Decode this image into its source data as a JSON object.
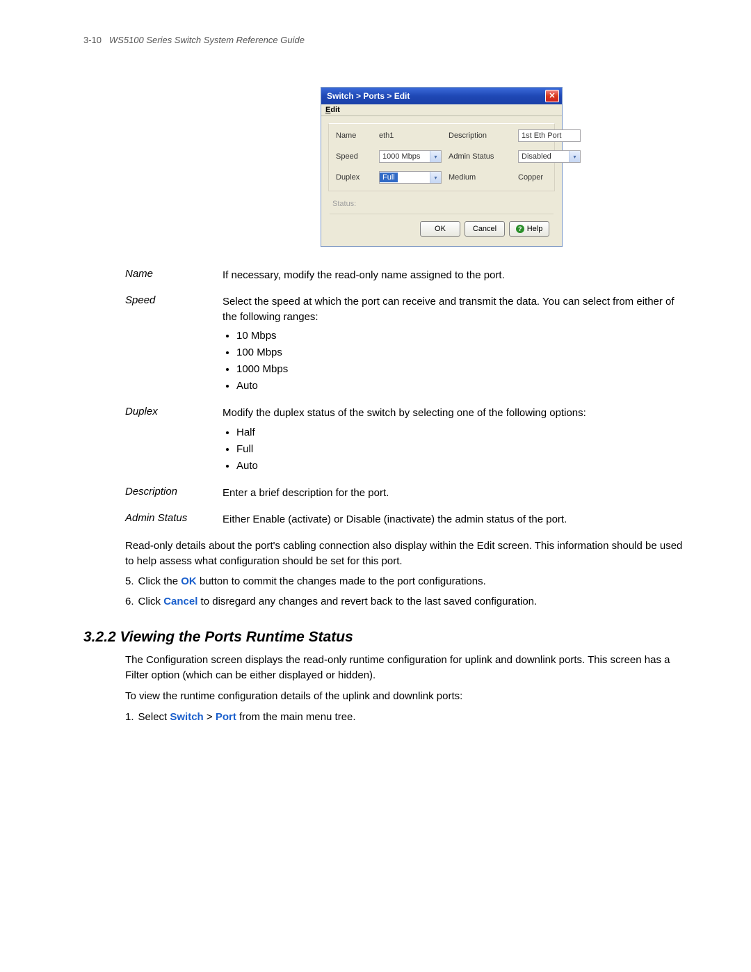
{
  "header": {
    "page_num": "3-10",
    "doc_title": "WS5100 Series Switch System Reference Guide"
  },
  "dialog": {
    "title": "Switch > Ports > Edit",
    "menu": {
      "edit": "Edit"
    },
    "fields": {
      "name_label": "Name",
      "name_value": "eth1",
      "speed_label": "Speed",
      "speed_value": "1000 Mbps",
      "duplex_label": "Duplex",
      "duplex_value": "Full",
      "description_label": "Description",
      "description_value": "1st Eth Port",
      "admin_status_label": "Admin Status",
      "admin_status_value": "Disabled",
      "medium_label": "Medium",
      "medium_value": "Copper"
    },
    "status_label": "Status:",
    "buttons": {
      "ok": "OK",
      "cancel": "Cancel",
      "help": "Help"
    }
  },
  "defs": {
    "name": {
      "term": "Name",
      "desc": "If necessary, modify the read-only name assigned to the port."
    },
    "speed": {
      "term": "Speed",
      "desc": "Select the speed at which the port can receive and transmit the data. You can select from either of the following ranges:",
      "items": [
        "10 Mbps",
        "100 Mbps",
        "1000 Mbps",
        "Auto"
      ]
    },
    "duplex": {
      "term": "Duplex",
      "desc": "Modify the duplex status of the switch by selecting one of the following options:",
      "items": [
        "Half",
        "Full",
        "Auto"
      ]
    },
    "description": {
      "term": "Description",
      "desc": "Enter a brief description for the port."
    },
    "admin_status": {
      "term": "Admin Status",
      "desc": "Either Enable (activate) or Disable (inactivate) the admin status of the port."
    }
  },
  "para_readonly": "Read-only details about the port's cabling connection also display within the Edit screen. This information should be used to help assess what configuration should be set for this port.",
  "step5": {
    "num": "5.",
    "pre": "Click the ",
    "bold": "OK",
    "post": " button to commit the changes made to the port configurations."
  },
  "step6": {
    "num": "6.",
    "pre": "Click ",
    "bold": "Cancel",
    "post": " to disregard any changes and revert back to the last saved configuration."
  },
  "section": {
    "heading": "3.2.2  Viewing the Ports Runtime Status",
    "p1": "The Configuration screen displays the read-only runtime configuration for uplink and downlink ports. This screen has a Filter option (which can be either displayed or hidden).",
    "p2": "To view the runtime configuration details of the uplink and downlink ports:",
    "step1": {
      "num": "1.",
      "pre": "Select ",
      "b1": "Switch",
      "gt": " > ",
      "b2": "Port",
      "post": " from the main menu tree."
    }
  }
}
